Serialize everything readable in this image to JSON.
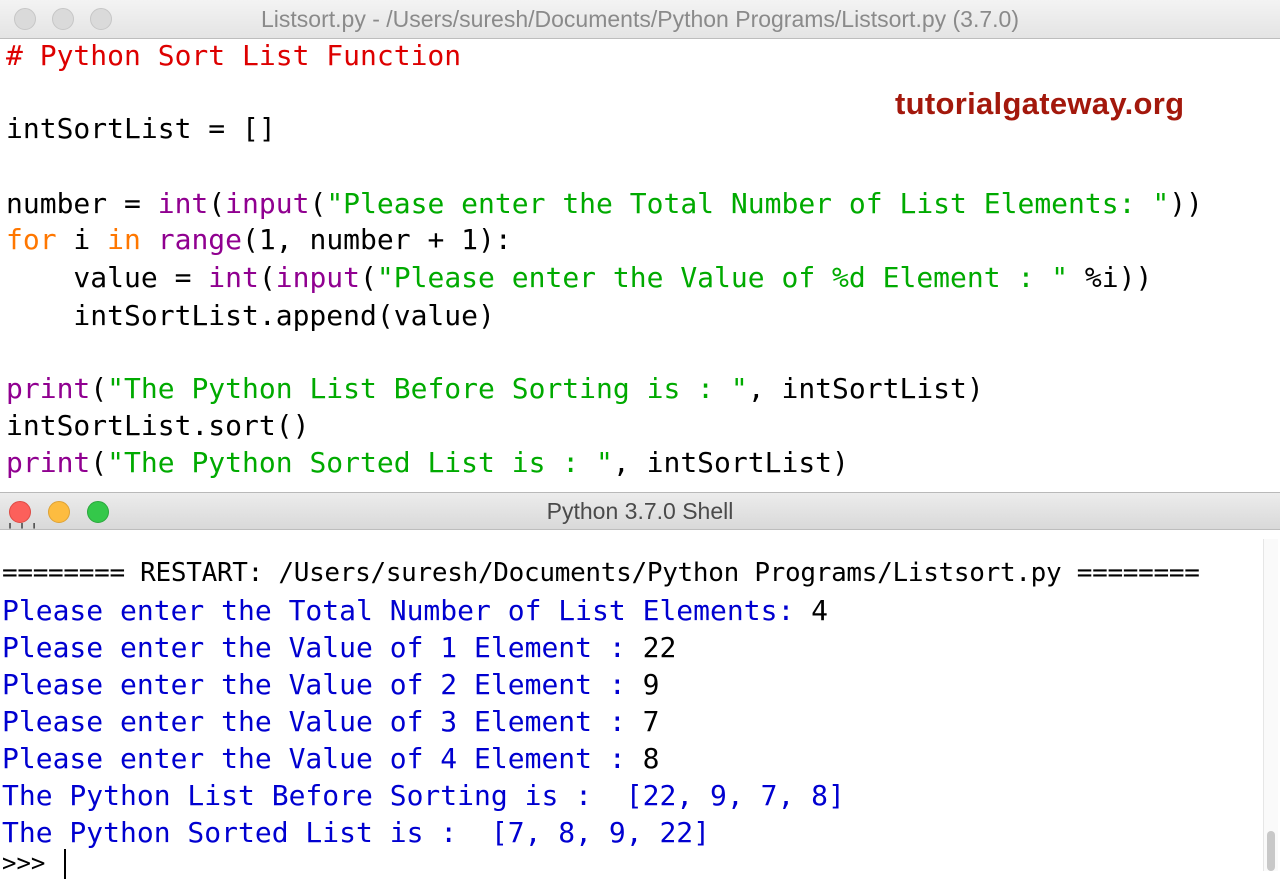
{
  "editor": {
    "title": "Listsort.py - /Users/suresh/Documents/Python Programs/Listsort.py (3.7.0)",
    "watermark": "tutorialgateway.org",
    "code": {
      "l1_comment": "# Python Sort List Function",
      "l3": "intSortList = []",
      "l5_a": "number = ",
      "l5_int": "int",
      "l5_b": "(",
      "l5_input": "input",
      "l5_c": "(",
      "l5_str": "\"Please enter the Total Number of List Elements: \"",
      "l5_d": "))",
      "l6_for": "for",
      "l6_a": " i ",
      "l6_in": "in",
      "l6_b": " ",
      "l6_range": "range",
      "l6_c": "(1, number + 1):",
      "l7_a": "    value = ",
      "l7_int": "int",
      "l7_b": "(",
      "l7_input": "input",
      "l7_c": "(",
      "l7_str": "\"Please enter the Value of %d Element : \"",
      "l7_d": " %i))",
      "l8": "    intSortList.append(value)",
      "l10_print": "print",
      "l10_a": "(",
      "l10_str": "\"The Python List Before Sorting is : \"",
      "l10_b": ", intSortList)",
      "l11": "intSortList.sort()",
      "l12_print": "print",
      "l12_a": "(",
      "l12_str": "\"The Python Sorted List is : \"",
      "l12_b": ", intSortList)"
    }
  },
  "shell": {
    "title": "Python 3.7.0 Shell",
    "partial_top": "'''",
    "restart": "======== RESTART: /Users/suresh/Documents/Python Programs/Listsort.py ========",
    "lines": [
      {
        "prompt": "Please enter the Total Number of List Elements: ",
        "input": "4"
      },
      {
        "prompt": "Please enter the Value of 1 Element : ",
        "input": "22"
      },
      {
        "prompt": "Please enter the Value of 2 Element : ",
        "input": "9"
      },
      {
        "prompt": "Please enter the Value of 3 Element : ",
        "input": "7"
      },
      {
        "prompt": "Please enter the Value of 4 Element : ",
        "input": "8"
      }
    ],
    "out1": "The Python List Before Sorting is :  [22, 9, 7, 8]",
    "out2": "The Python Sorted List is :  [7, 8, 9, 22]",
    "prompt": ">>> "
  },
  "colors": {
    "comment": "#dd0000",
    "keyword": "#ff7700",
    "builtin": "#900090",
    "string": "#00aa00",
    "shell_output": "#0000d0",
    "brand": "#a3180c"
  }
}
